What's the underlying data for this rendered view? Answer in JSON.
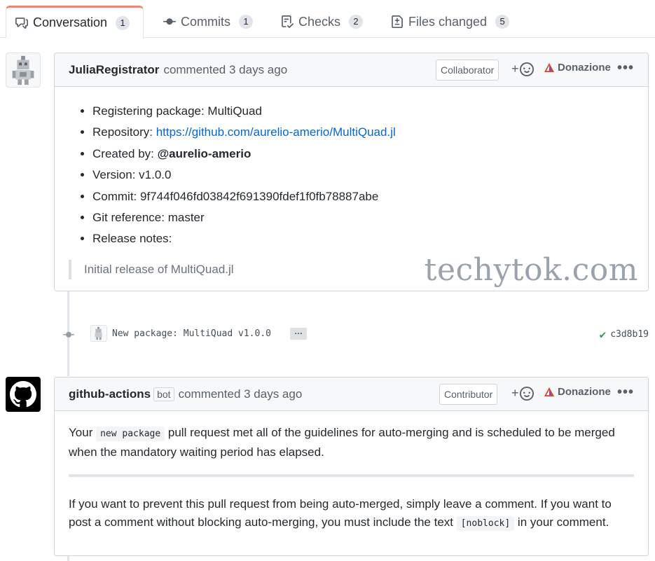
{
  "tabs": [
    {
      "label": "Conversation",
      "count": "1",
      "icon": "conversation-icon"
    },
    {
      "label": "Commits",
      "count": "1",
      "icon": "commit-icon"
    },
    {
      "label": "Checks",
      "count": "2",
      "icon": "checklist-icon"
    },
    {
      "label": "Files changed",
      "count": "5",
      "icon": "file-diff-icon"
    }
  ],
  "comment1": {
    "author": "JuliaRegistrator",
    "meta": "commented 3 days ago",
    "badge": "Collaborator",
    "react": "+",
    "donate": "Donazione",
    "dots": "•••",
    "items": {
      "package": "Registering package: MultiQuad",
      "repo_label": "Repository: ",
      "repo_link": "https://github.com/aurelio-amerio/MultiQuad.jl",
      "created_label": "Created by: ",
      "created_by": "@aurelio-amerio",
      "version": "Version: v1.0.0",
      "commit": "Commit: 9f744f046fd03842f691390fdef1f0fb78887abe",
      "gitref": "Git reference: master",
      "notes": "Release notes:"
    },
    "quote": "Initial release of MultiQuad.jl",
    "watermark": "techytok.com"
  },
  "commit_event": {
    "message": "New package: MultiQuad v1.0.0",
    "expander": "…",
    "sha": "c3d8b19",
    "status": "success"
  },
  "comment2": {
    "author": "github-actions",
    "bot": "bot",
    "meta": "commented 3 days ago",
    "badge": "Contributor",
    "react": "+",
    "donate": "Donazione",
    "dots": "•••",
    "p1_before": "Your ",
    "p1_code": "new package",
    "p1_after": " pull request met all of the guidelines for auto-merging and is scheduled to be merged when the mandatory waiting period has elapsed.",
    "p2_before": "If you want to prevent this pull request from being auto-merged, simply leave a comment. If you want to post a comment without blocking auto-merging, you must include the text ",
    "p2_code": "[noblock]",
    "p2_after": " in your comment."
  },
  "colors": {
    "accent_tab": "#f9826c",
    "link": "#0366d6",
    "success": "#28a745",
    "brave": "#e2401b"
  }
}
